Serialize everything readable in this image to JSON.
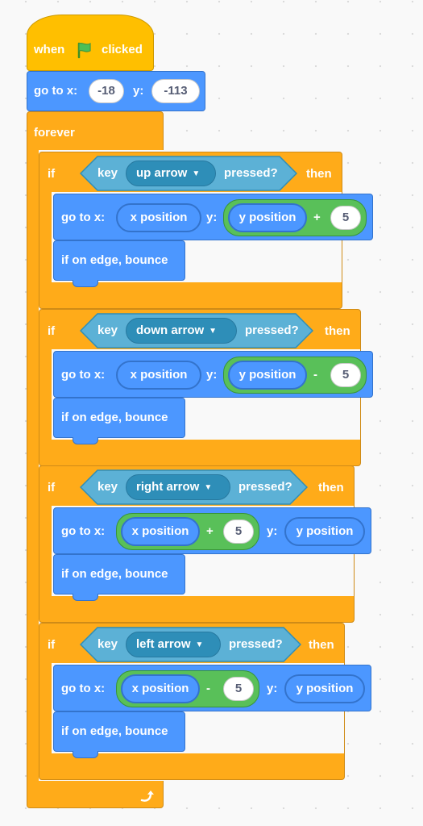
{
  "hat": {
    "when": "when",
    "clicked": "clicked",
    "flag_icon": "green-flag-icon"
  },
  "start_goto": {
    "label": "go to x:",
    "x": "-18",
    "y_label": "y:",
    "y": "-113"
  },
  "forever": {
    "label": "forever",
    "loop_icon": "loop-arrow-icon"
  },
  "ifs": [
    {
      "if": "if",
      "key": "key",
      "menu": "up arrow",
      "pressed": "pressed?",
      "then": "then",
      "goto": {
        "label": "go to x:",
        "x": "x position",
        "y_label": "y:",
        "y": "y position",
        "op": "+",
        "num": "5"
      },
      "bounce": "if on edge, bounce"
    },
    {
      "if": "if",
      "key": "key",
      "menu": "down arrow",
      "pressed": "pressed?",
      "then": "then",
      "goto": {
        "label": "go to x:",
        "x": "x position",
        "y_label": "y:",
        "y": "y position",
        "op": "-",
        "num": "5"
      },
      "bounce": "if on edge, bounce"
    },
    {
      "if": "if",
      "key": "key",
      "menu": "right arrow",
      "pressed": "pressed?",
      "then": "then",
      "goto": {
        "label": "go to x:",
        "x": "x position",
        "op": "+",
        "num": "5",
        "y_label": "y:",
        "y": "y position"
      },
      "bounce": "if on edge, bounce"
    },
    {
      "if": "if",
      "key": "key",
      "menu": "left arrow",
      "pressed": "pressed?",
      "then": "then",
      "goto": {
        "label": "go to x:",
        "x": "x position",
        "op": "-",
        "num": "5",
        "y_label": "y:",
        "y": "y position"
      },
      "bounce": "if on edge, bounce"
    }
  ],
  "colors": {
    "events": "#ffbf00",
    "control": "#ffab19",
    "motion": "#4c97ff",
    "sensing": "#5cb1d6",
    "operators": "#59c059"
  }
}
